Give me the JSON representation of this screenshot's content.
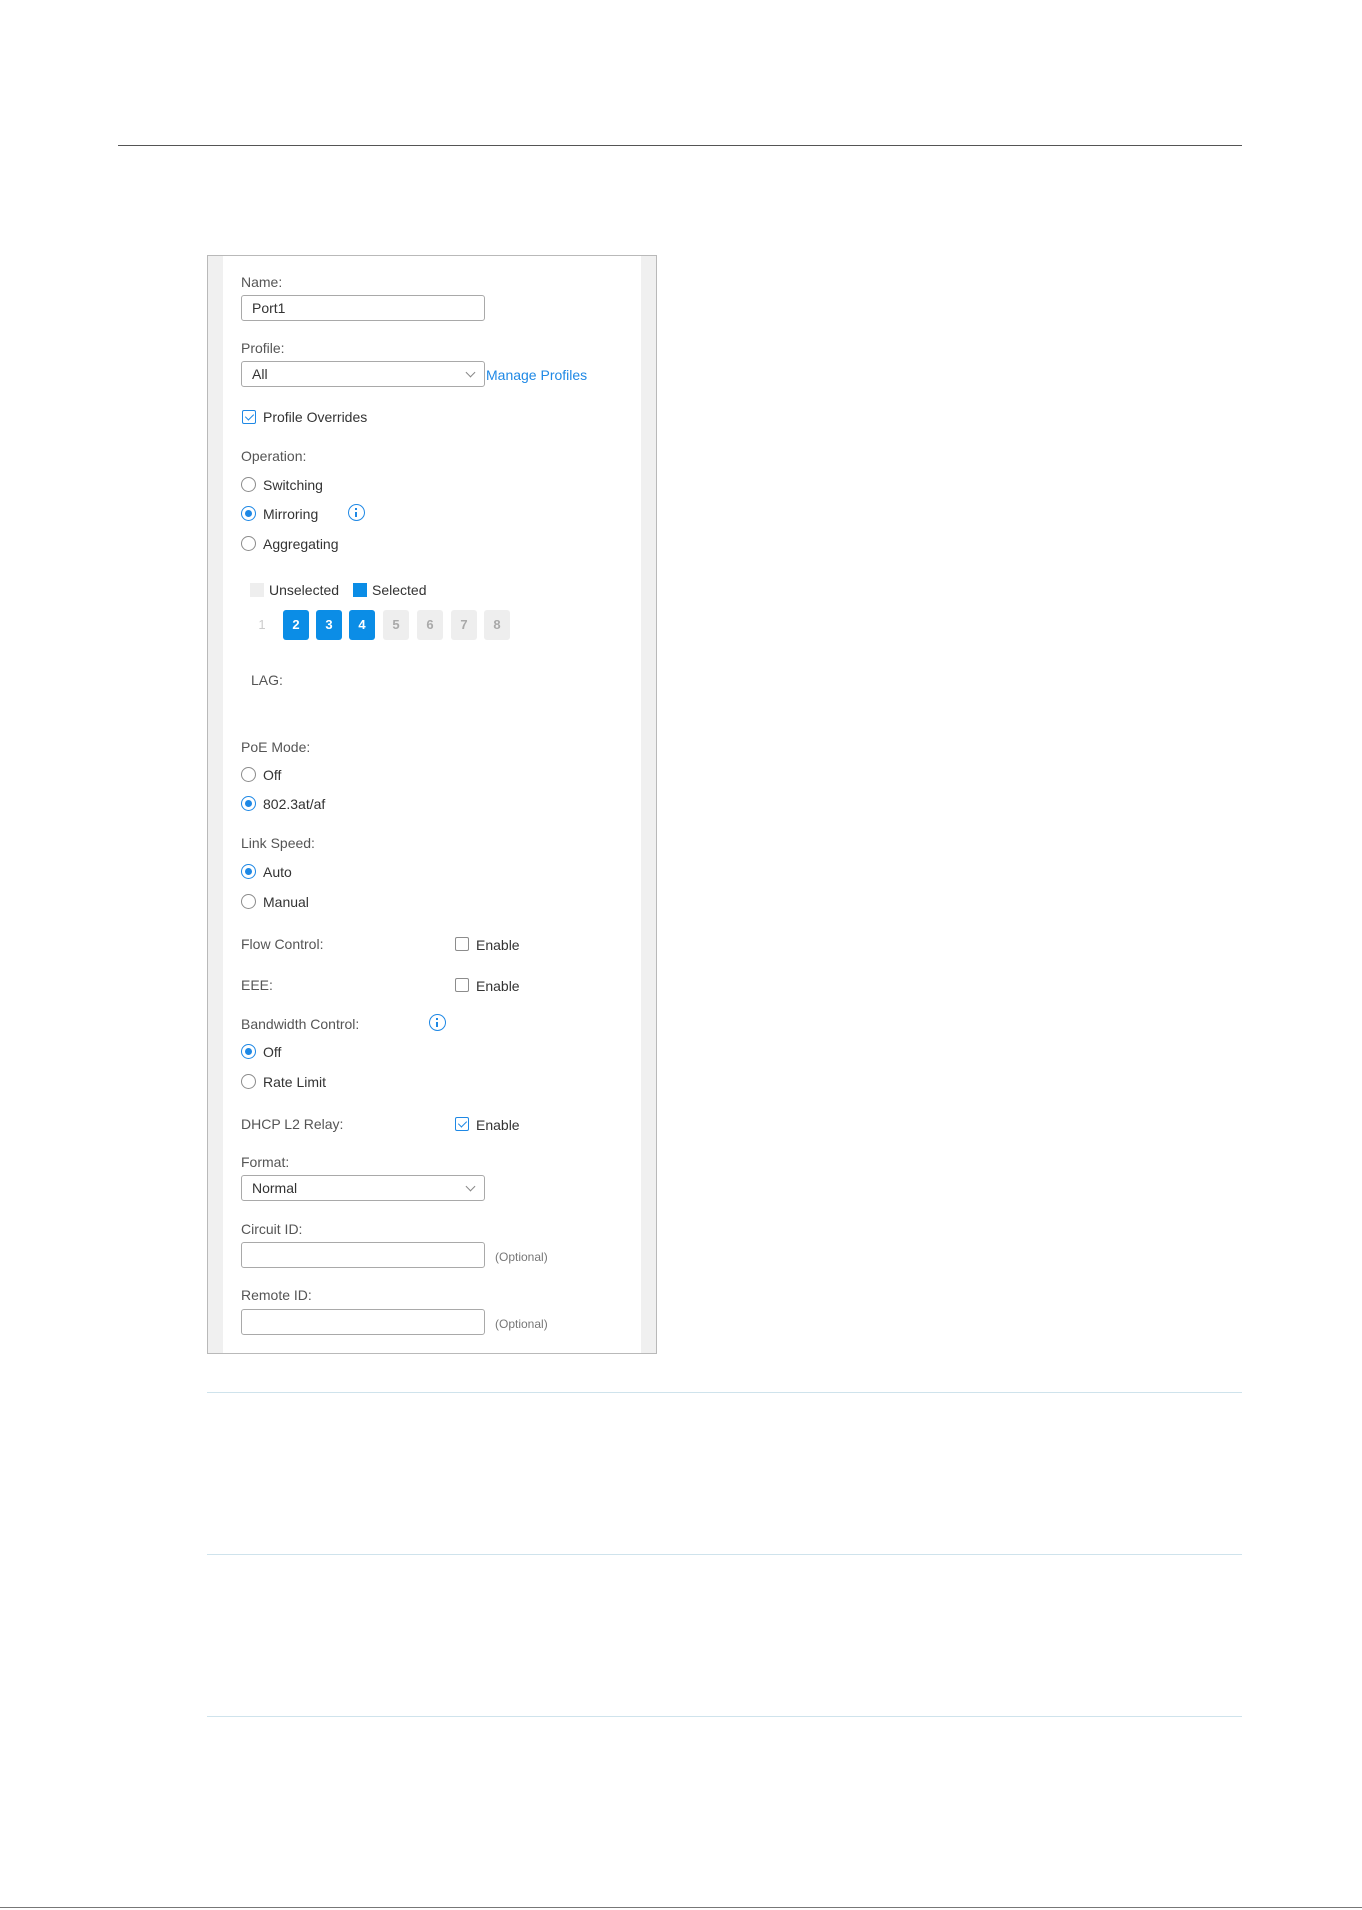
{
  "form": {
    "name_label": "Name:",
    "name_value": "Port1",
    "profile_label": "Profile:",
    "profile_value": "All",
    "manage_profiles_link": "Manage Profiles",
    "profile_overrides_label": "Profile Overrides",
    "profile_overrides_checked": true,
    "operation_label": "Operation:",
    "operation_options": [
      "Switching",
      "Mirroring",
      "Aggregating"
    ],
    "operation_selected": "Mirroring",
    "legend_unselected": "Unselected",
    "legend_selected": "Selected",
    "ports": [
      {
        "num": "1",
        "state": "disabled"
      },
      {
        "num": "2",
        "state": "selected"
      },
      {
        "num": "3",
        "state": "selected"
      },
      {
        "num": "4",
        "state": "selected"
      },
      {
        "num": "5",
        "state": "unselected"
      },
      {
        "num": "6",
        "state": "unselected"
      },
      {
        "num": "7",
        "state": "unselected"
      },
      {
        "num": "8",
        "state": "unselected"
      }
    ],
    "lag_label": "LAG:",
    "poe_label": "PoE Mode:",
    "poe_options": [
      "Off",
      "802.3at/af"
    ],
    "poe_selected": "802.3at/af",
    "link_speed_label": "Link Speed:",
    "link_speed_options": [
      "Auto",
      "Manual"
    ],
    "link_speed_selected": "Auto",
    "flow_control_label": "Flow Control:",
    "flow_control_enable": "Enable",
    "flow_control_checked": false,
    "eee_label": "EEE:",
    "eee_enable": "Enable",
    "eee_checked": false,
    "bandwidth_label": "Bandwidth Control:",
    "bandwidth_options": [
      "Off",
      "Rate Limit"
    ],
    "bandwidth_selected": "Off",
    "dhcp_label": "DHCP L2 Relay:",
    "dhcp_enable": "Enable",
    "dhcp_checked": true,
    "format_label": "Format:",
    "format_value": "Normal",
    "circuit_id_label": "Circuit ID:",
    "circuit_id_value": "",
    "circuit_id_hint": "(Optional)",
    "remote_id_label": "Remote ID:",
    "remote_id_value": "",
    "remote_id_hint": "(Optional)"
  },
  "colors": {
    "accent": "#1e88e5",
    "port_selected": "#0b8de6",
    "port_unselected": "#eeeeee"
  }
}
